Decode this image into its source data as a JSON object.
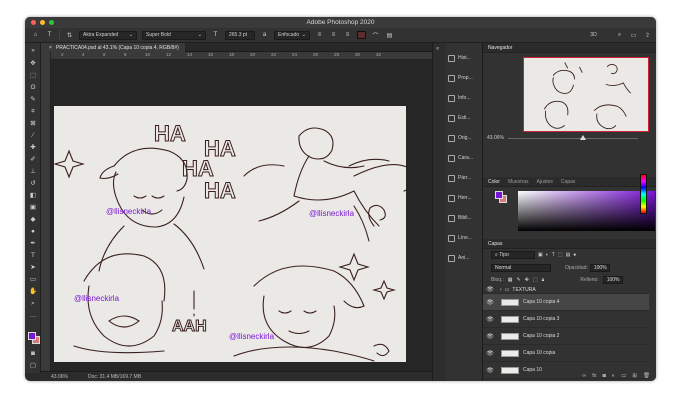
{
  "window": {
    "title": "Adobe Photoshop 2020"
  },
  "options_bar": {
    "font_family": "Akira Expanded",
    "font_style": "Super Bold",
    "font_size": "265.3 pt",
    "antialias": "Enfocado",
    "text_color": "#5b2c2c"
  },
  "document": {
    "tab_label": "PRACTICA04.psd al 43.1% (Capa 10 copia 4, RGB/8#)",
    "watermark": "@llisneckirla"
  },
  "rulers": {
    "marks": [
      "2",
      "4",
      "6",
      "8",
      "10",
      "12",
      "14",
      "16",
      "18",
      "20",
      "22",
      "24",
      "26",
      "28",
      "30",
      "32"
    ]
  },
  "status": {
    "zoom": "43.06%",
    "doc": "Doc: 31.4 MB/169.7 MB"
  },
  "panel_strip": {
    "items": [
      {
        "label": "Hist...",
        "icon": "history-icon"
      },
      {
        "label": "Prop...",
        "icon": "properties-icon"
      },
      {
        "label": "Info...",
        "icon": "info-icon"
      },
      {
        "label": "Esti...",
        "icon": "paragraph-styles-icon"
      },
      {
        "label": "Orig...",
        "icon": "clone-source-icon"
      },
      {
        "label": "Cara...",
        "icon": "character-icon"
      },
      {
        "label": "Párr...",
        "icon": "paragraph-icon"
      },
      {
        "label": "Herr...",
        "icon": "tool-presets-icon"
      },
      {
        "label": "Bibli...",
        "icon": "libraries-icon"
      },
      {
        "label": "Líne...",
        "icon": "timeline-icon"
      },
      {
        "label": "Ani...",
        "icon": "animation-icon"
      }
    ]
  },
  "navigator": {
    "title": "Navegador",
    "zoom": "43.06%"
  },
  "color_panel": {
    "tabs": [
      "Color",
      "Muestras",
      "Ajustes",
      "Capas"
    ],
    "foreground": "#7a16d6",
    "background": "#d97a7a"
  },
  "layers": {
    "title": "Capas",
    "filter": "Tipo",
    "blend_mode": "Normal",
    "opacity_label": "Opacidad:",
    "opacity": "100%",
    "lock_label": "Bloq.:",
    "fill_label": "Relleno:",
    "fill": "100%",
    "items": [
      {
        "name": "TEXTURA",
        "type": "group",
        "selected": false
      },
      {
        "name": "Capa 10 copia 4",
        "type": "layer",
        "selected": true
      },
      {
        "name": "Capa 10 copia 3",
        "type": "layer",
        "selected": false
      },
      {
        "name": "Capa 10 copia 2",
        "type": "layer",
        "selected": false
      },
      {
        "name": "Capa 10 copia",
        "type": "layer",
        "selected": false
      },
      {
        "name": "Capa 10",
        "type": "layer",
        "selected": false
      }
    ]
  },
  "artwork_text": {
    "ha1": "HA",
    "ha2": "HA",
    "ha3": "HA",
    "ha4": "HA",
    "aah": "AAH"
  }
}
